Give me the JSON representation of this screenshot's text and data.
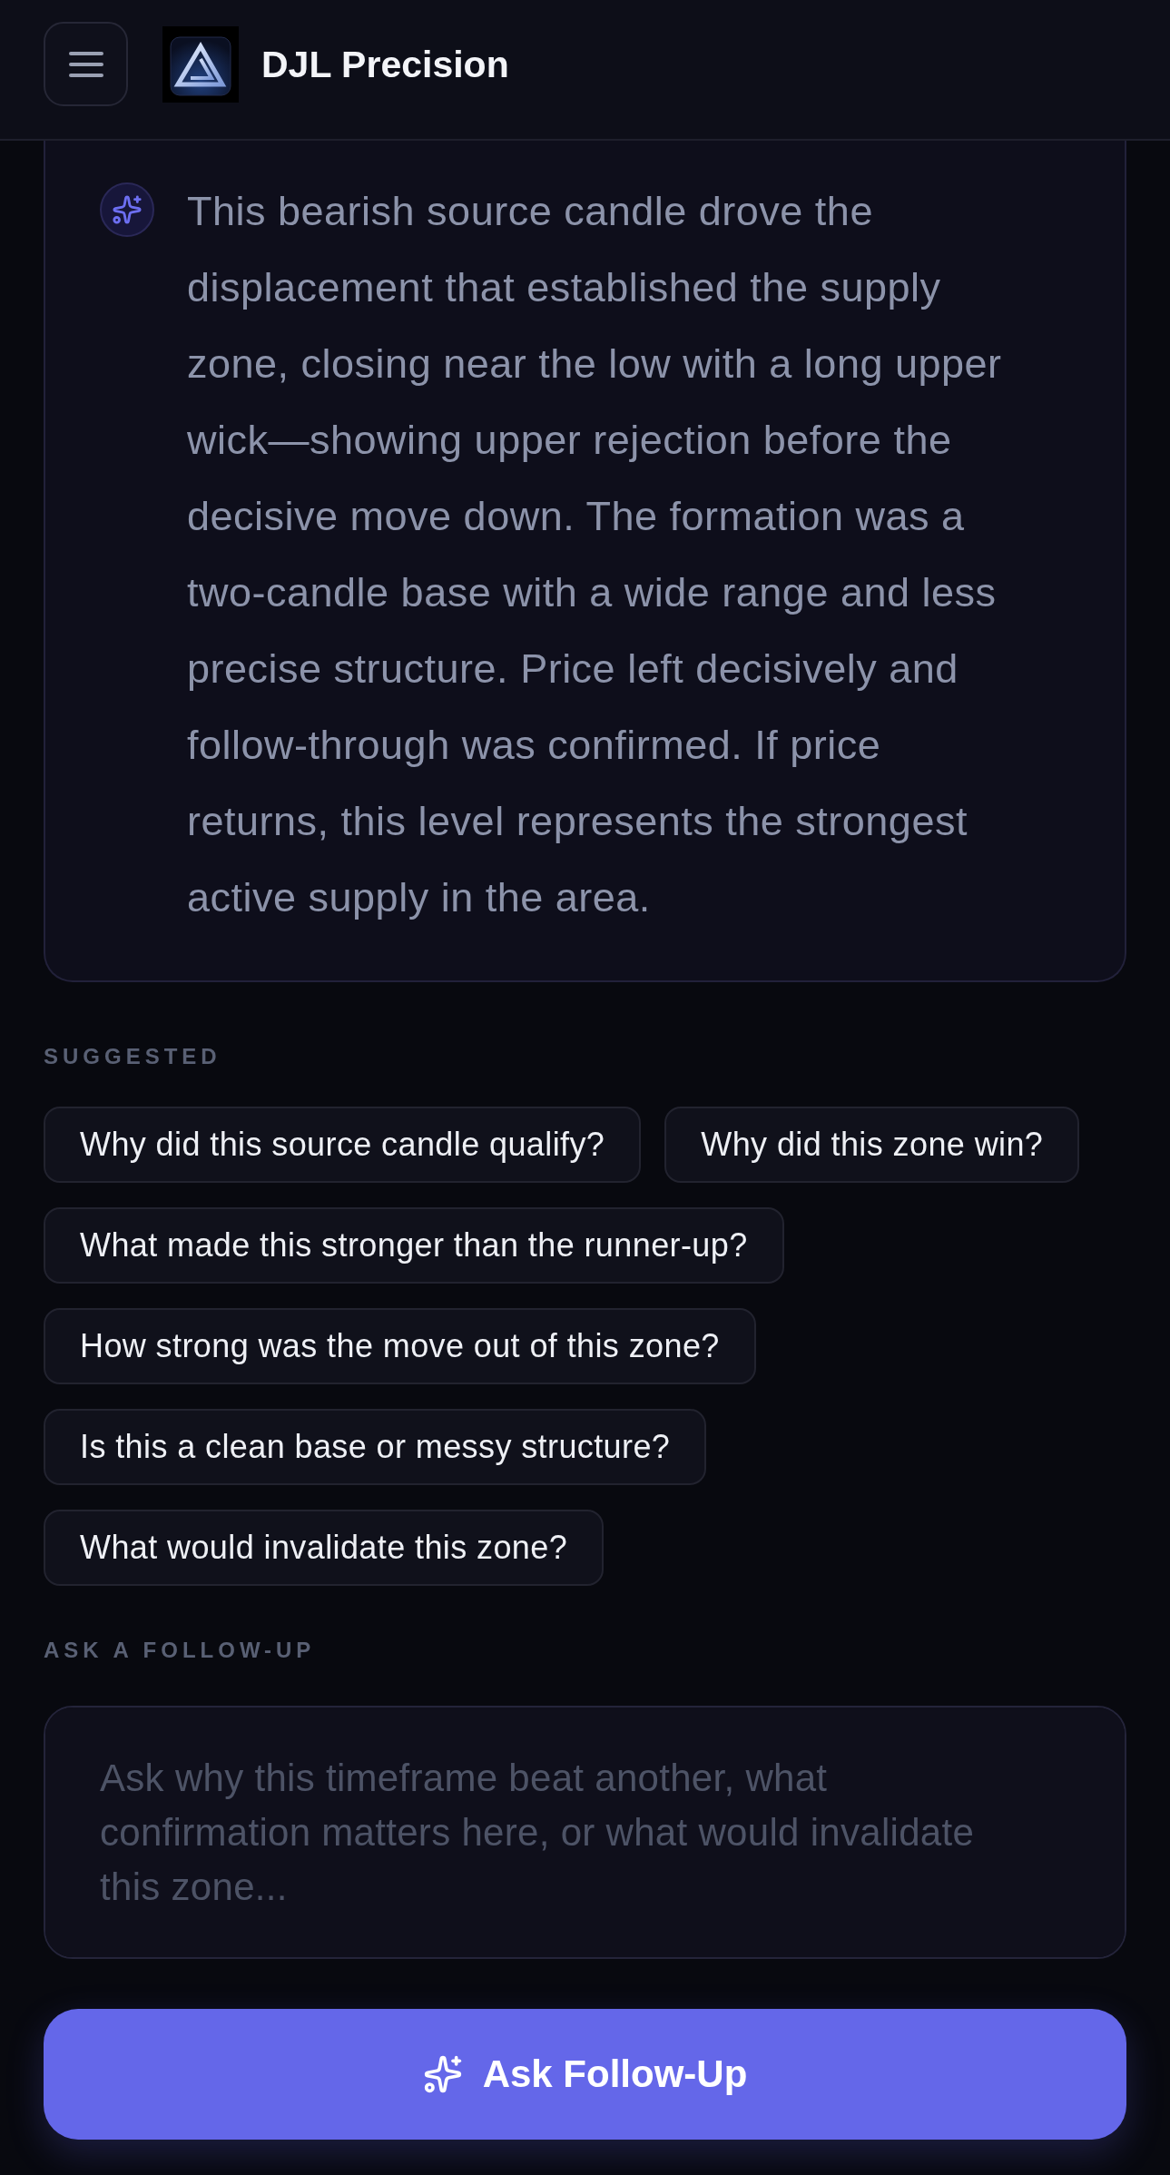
{
  "header": {
    "title": "DJL Precision"
  },
  "answer": {
    "text": "This bearish source candle drove the displacement that established the supply zone, closing near the low with a long upper wick—showing upper rejection before the decisive move down. The formation was a two-candle base with a wide range and less precise structure. Price left decisively and follow-through was confirmed. If price returns, this level represents the strongest active supply in the area."
  },
  "suggested": {
    "label": "SUGGESTED",
    "chips": [
      "Why did this source candle qualify?",
      "Why did this zone win?",
      "What made this stronger than the runner-up?",
      "How strong was the move out of this zone?",
      "Is this a clean base or messy structure?",
      "What would invalidate this zone?"
    ]
  },
  "follow_up": {
    "label": "ASK A FOLLOW-UP",
    "placeholder": "Ask why this timeframe beat another, what confirmation matters here, or what would invalidate this zone...",
    "button": "Ask Follow-Up"
  }
}
